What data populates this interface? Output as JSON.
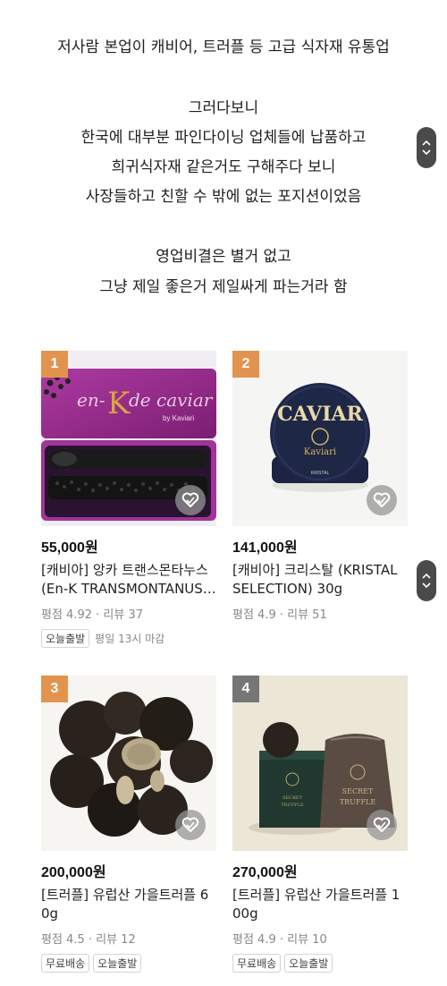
{
  "article": {
    "lines": [
      "저사람 본업이 캐비어, 트러플 등 고급 식자재 유통업",
      "그러다보니",
      "한국에 대부분 파인다이닝 업체들에 납품하고",
      "희귀식자재 같은거도 구해주다 보니",
      "사장들하고 친할 수 밖에 없는 포지션이었음",
      "영업비결은 별거 없고",
      "그냥 제일 좋은거 제일싸게 파는거라 함"
    ]
  },
  "products": [
    {
      "rank": "1",
      "price": "55,000원",
      "name": "[캐비아] 앙카 트랜스몬타누스 (En-K TRANSMONTANUS…",
      "rating_text": "평점 4.92 · 리뷰 37",
      "tags": [
        "오늘출발"
      ],
      "tag_note": "평일 13시 마감",
      "image_text": {
        "brand": "en-Kde caviar",
        "sub": "by Kaviari"
      }
    },
    {
      "rank": "2",
      "price": "141,000원",
      "name": "[캐비아] 크리스탈 (KRISTAL SELECTION) 30g",
      "rating_text": "평점 4.9 · 리뷰 51",
      "tags": [],
      "tag_note": "",
      "image_text": {
        "title": "CAVIAR",
        "brand": "Kaviari",
        "sub": "KRISTAL"
      }
    },
    {
      "rank": "3",
      "price": "200,000원",
      "name": "[트러플] 유럽산 가을트러플 60g",
      "rating_text": "평점 4.5 · 리뷰 12",
      "tags": [
        "무료배송",
        "오늘출발"
      ],
      "tag_note": ""
    },
    {
      "rank": "4",
      "price": "270,000원",
      "name": "[트러플] 유럽산 가을트러플 100g",
      "rating_text": "평점 4.9 · 리뷰 10",
      "tags": [
        "무료배송",
        "오늘출발"
      ],
      "tag_note": "",
      "image_text": {
        "bag": "SECRET TRUFFLE",
        "box": "SECRET TRUFFLE"
      }
    }
  ],
  "colors": {
    "rank_top": "#e2944f",
    "rank_other": "#767676"
  },
  "icons": {
    "wishlist": "heart-icon",
    "scroll": [
      "chevron-up-icon",
      "chevron-down-icon"
    ]
  }
}
